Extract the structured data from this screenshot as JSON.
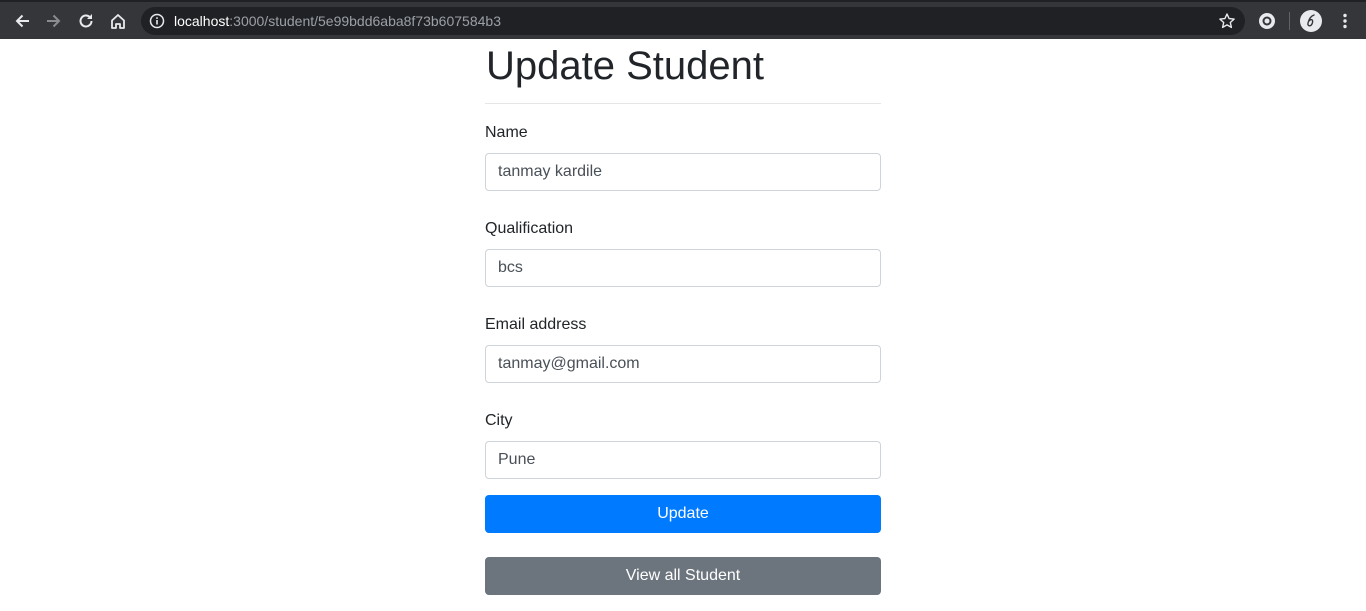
{
  "browser": {
    "url_host": "localhost",
    "url_path": ":3000/student/5e99bdd6aba8f73b607584b3",
    "icons": [
      "back-icon",
      "forward-icon",
      "reload-icon",
      "home-icon",
      "info-icon",
      "star-icon",
      "extension-icon",
      "avatar",
      "menu-icon"
    ]
  },
  "page": {
    "title": "Update Student"
  },
  "form": {
    "name_label": "Name",
    "name_value": "tanmay kardile",
    "qualification_label": "Qualification",
    "qualification_value": "bcs",
    "email_label": "Email address",
    "email_value": "tanmay@gmail.com",
    "city_label": "City",
    "city_value": "Pune",
    "update_label": "Update",
    "view_all_label": "View all Student"
  },
  "colors": {
    "primary": "#007bff",
    "secondary": "#6c757d",
    "toolbar": "#35363a"
  }
}
